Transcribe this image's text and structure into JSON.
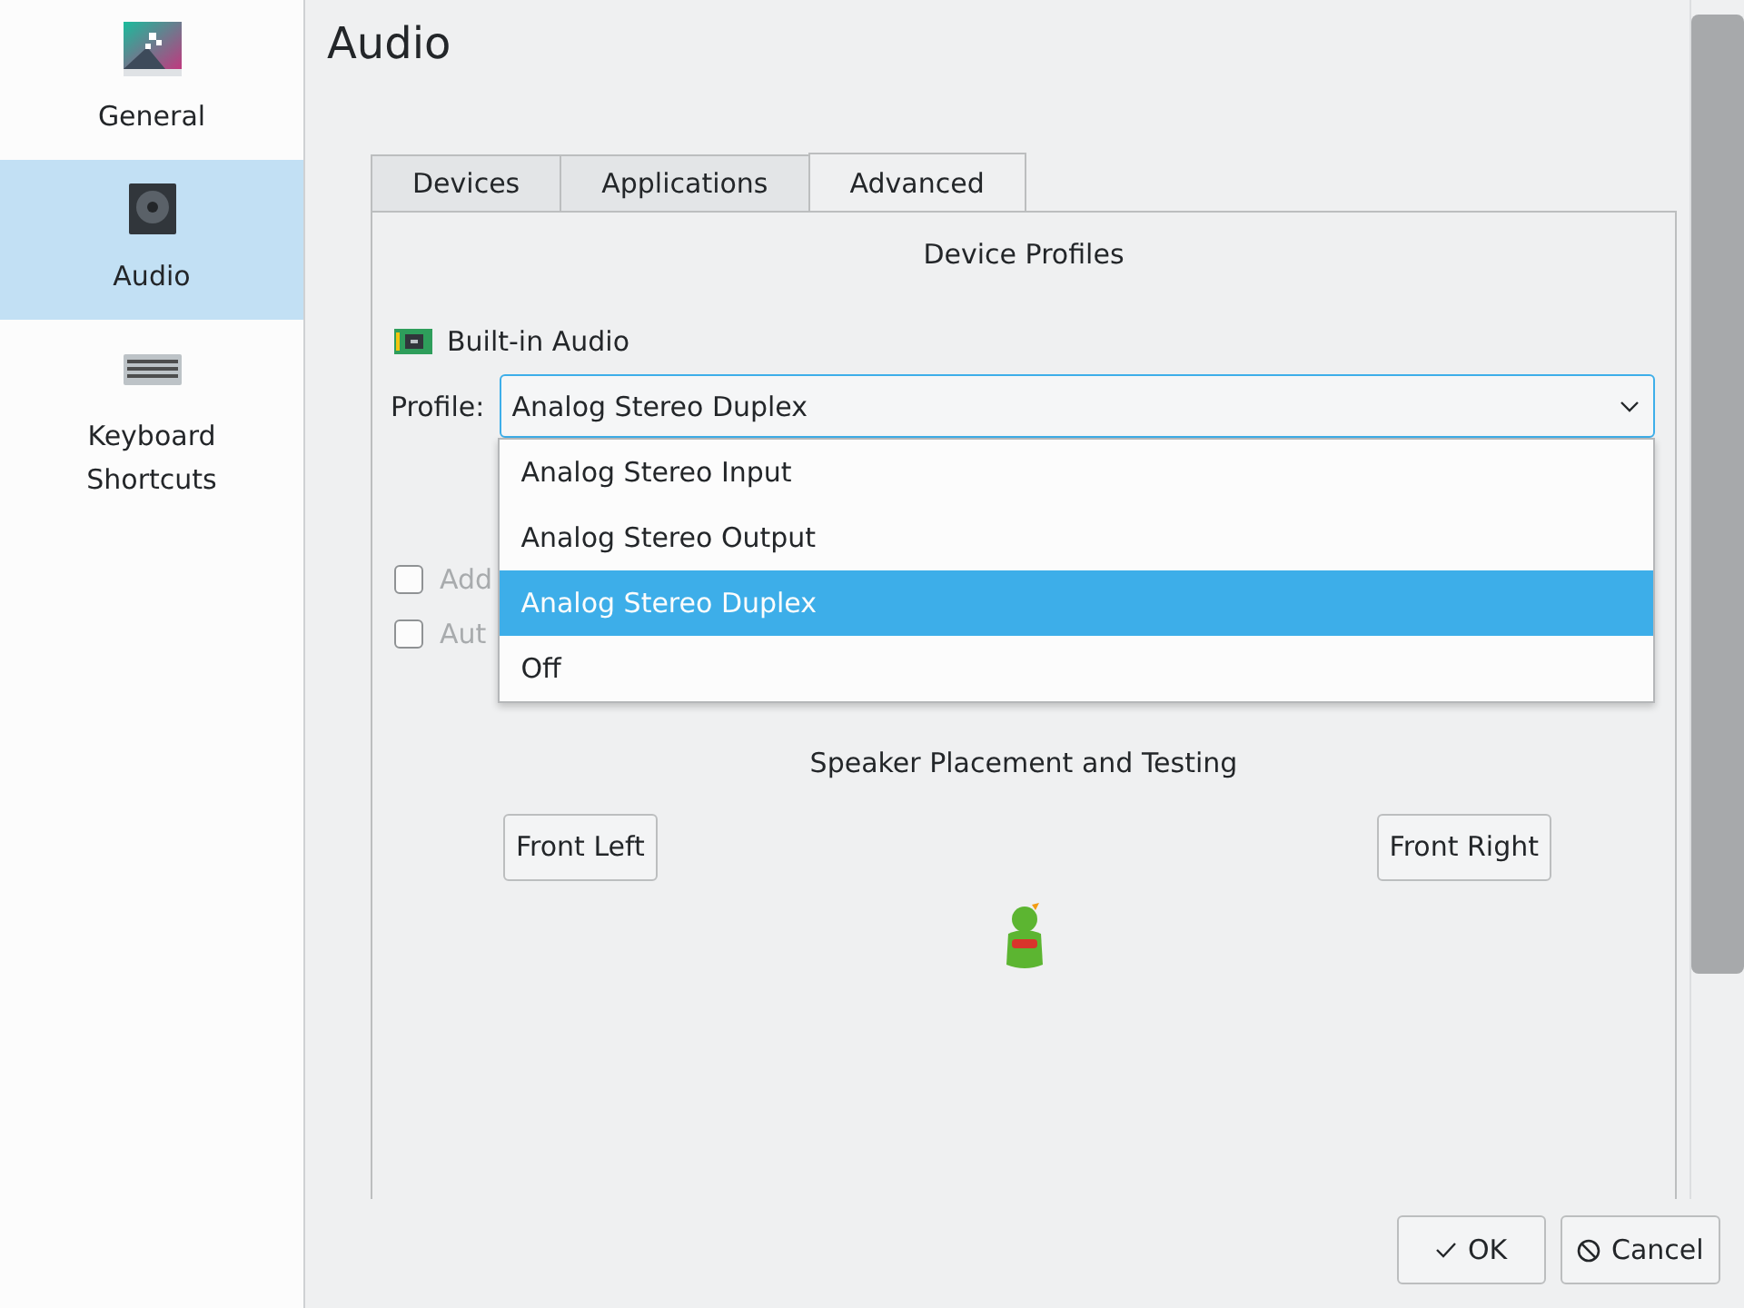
{
  "sidebar": {
    "items": [
      {
        "kind": "general",
        "label": "General",
        "selected": false
      },
      {
        "kind": "audio",
        "label": "Audio",
        "selected": true
      },
      {
        "kind": "keyboard",
        "label": "Keyboard Shortcuts",
        "selected": false
      }
    ]
  },
  "page_title": "Audio",
  "tabs": [
    {
      "label": "Devices",
      "selected": false
    },
    {
      "label": "Applications",
      "selected": false
    },
    {
      "label": "Advanced",
      "selected": true
    }
  ],
  "device_profiles": {
    "heading": "Device Profiles",
    "device": "Built-in Audio",
    "profile_label": "Profile:",
    "profile_value": "Analog Stereo Duplex",
    "expanded": true,
    "options": [
      {
        "label": "Analog Stereo Input",
        "selected": false
      },
      {
        "label": "Analog Stereo Output",
        "selected": false
      },
      {
        "label": "Analog Stereo Duplex",
        "selected": true
      },
      {
        "label": "Off",
        "selected": false
      }
    ]
  },
  "settings": [
    {
      "label": "Add",
      "checked": false,
      "disabled": true
    },
    {
      "label": "Aut",
      "checked": false,
      "disabled": true
    }
  ],
  "speaker_test": {
    "heading": "Speaker Placement and Testing",
    "buttons": [
      "Front Left",
      "Front Right"
    ]
  },
  "dialog_buttons": [
    {
      "kind": "ok",
      "label": "OK"
    },
    {
      "kind": "cancel",
      "label": "Cancel"
    }
  ]
}
